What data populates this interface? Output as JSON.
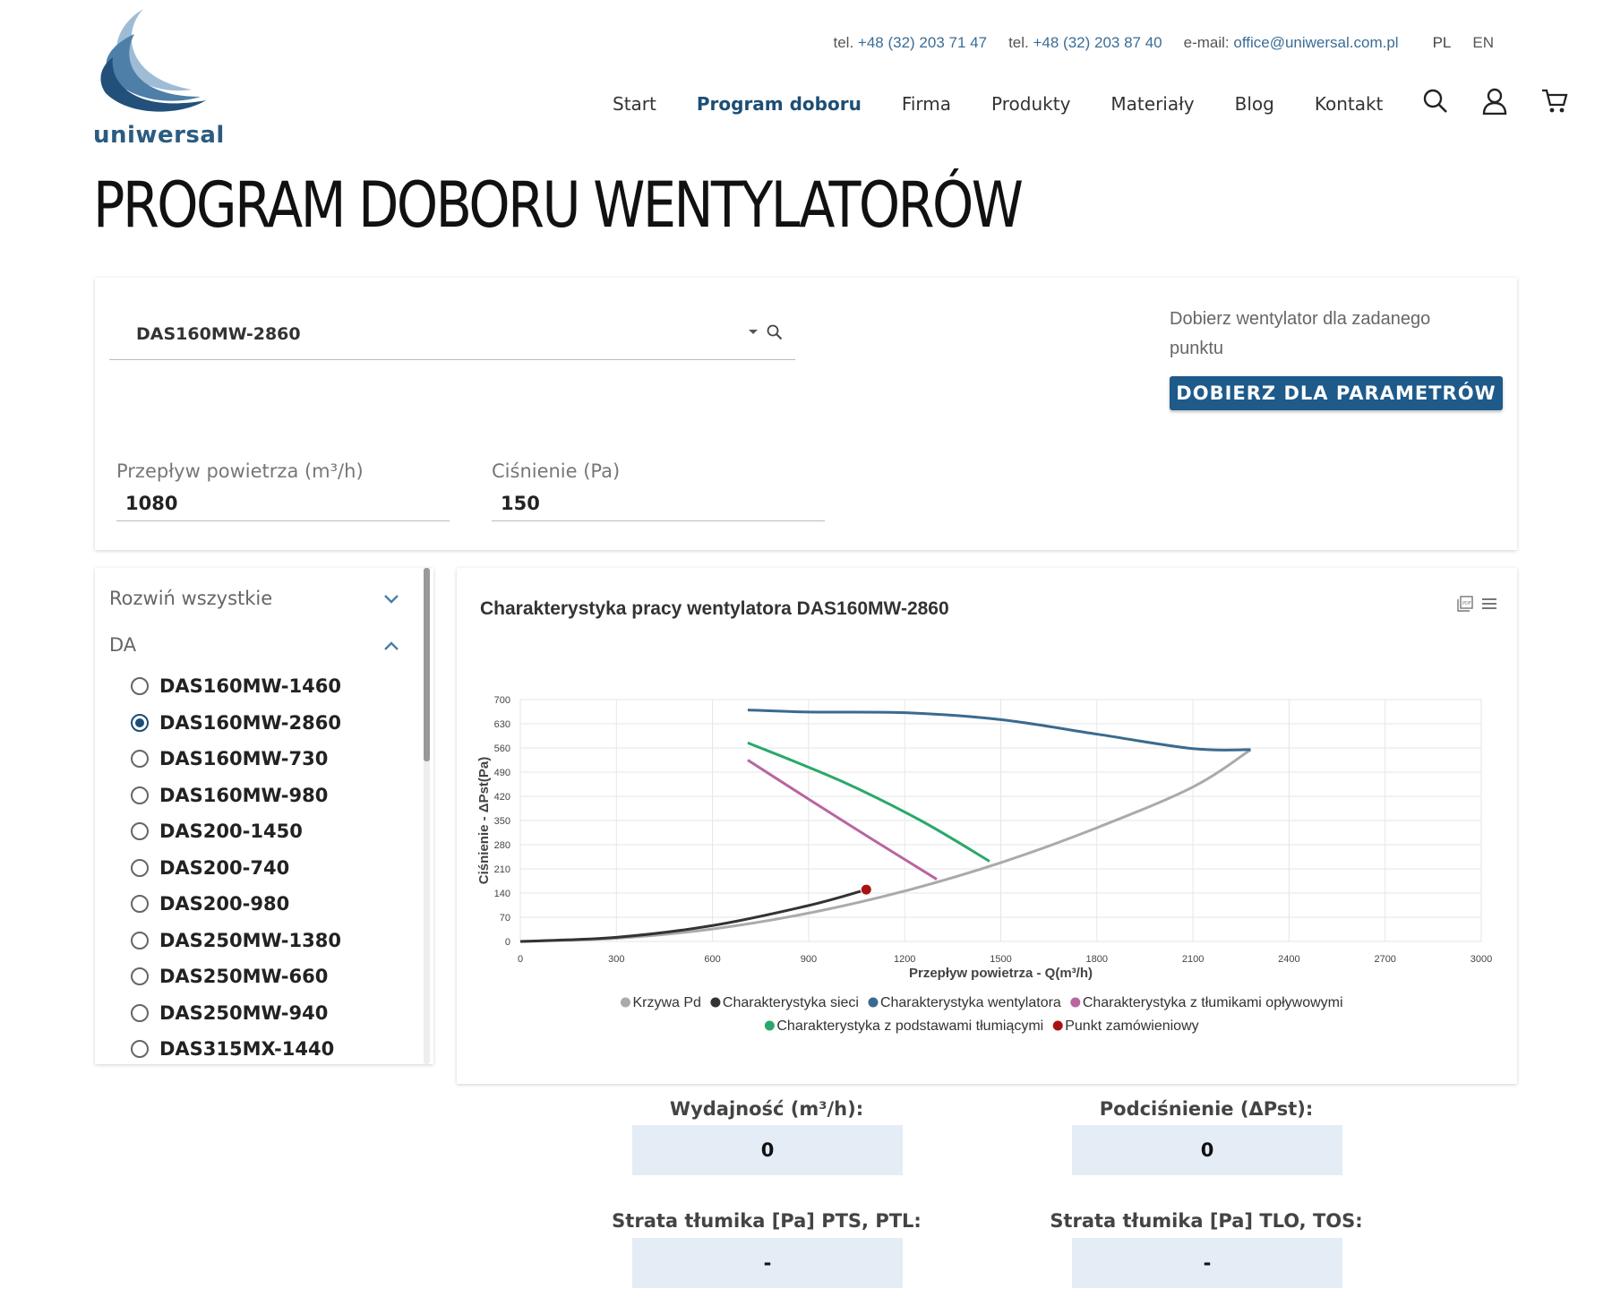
{
  "brand": {
    "name": "uniwersal"
  },
  "contact": {
    "tel1_label": "tel.",
    "tel1": "+48 (32) 203 71 47",
    "tel2_label": "tel.",
    "tel2": "+48 (32) 203 87 40",
    "email_label": "e-mail:",
    "email": "office@uniwersal.com.pl",
    "lang_pl": "PL",
    "lang_en": "EN"
  },
  "nav": {
    "items": [
      {
        "label": "Start",
        "active": false
      },
      {
        "label": "Program doboru",
        "active": true
      },
      {
        "label": "Firma",
        "active": false
      },
      {
        "label": "Produkty",
        "active": false
      },
      {
        "label": "Materiały",
        "active": false
      },
      {
        "label": "Blog",
        "active": false
      },
      {
        "label": "Kontakt",
        "active": false
      }
    ],
    "icons": [
      "search-icon",
      "user-icon",
      "cart-icon"
    ]
  },
  "page": {
    "title": "PROGRAM DOBORU WENTYLATORÓW"
  },
  "selector": {
    "value": "DAS160MW-2860",
    "pick_text": "Dobierz wentylator dla zadanego punktu",
    "pick_button": "DOBIERZ DLA PARAMETRÓW"
  },
  "fields": {
    "flow_label": "Przepływ powietrza (m³/h)",
    "flow_value": "1080",
    "pressure_label": "Ciśnienie (Pa)",
    "pressure_value": "150"
  },
  "sidebar": {
    "expand_all": "Rozwiń wszystkie",
    "group": "DA",
    "items": [
      {
        "label": "DAS160MW-1460",
        "selected": false
      },
      {
        "label": "DAS160MW-2860",
        "selected": true
      },
      {
        "label": "DAS160MW-730",
        "selected": false
      },
      {
        "label": "DAS160MW-980",
        "selected": false
      },
      {
        "label": "DAS200-1450",
        "selected": false
      },
      {
        "label": "DAS200-740",
        "selected": false
      },
      {
        "label": "DAS200-980",
        "selected": false
      },
      {
        "label": "DAS250MW-1380",
        "selected": false
      },
      {
        "label": "DAS250MW-660",
        "selected": false
      },
      {
        "label": "DAS250MW-940",
        "selected": false
      },
      {
        "label": "DAS315MX-1440",
        "selected": false
      }
    ]
  },
  "chart_data": {
    "type": "line",
    "title": "Charakterystyka pracy wentylatora DAS160MW-2860",
    "xlabel": "Przepływ powietrza - Q(m³/h)",
    "ylabel": "Ciśnienie - ΔPst(Pa)",
    "xlim": [
      0,
      3000
    ],
    "ylim": [
      0,
      700
    ],
    "xticks": [
      0,
      300,
      600,
      900,
      1200,
      1500,
      1800,
      2100,
      2400,
      2700,
      3000
    ],
    "yticks": [
      0,
      70,
      140,
      210,
      280,
      350,
      420,
      490,
      560,
      630,
      700
    ],
    "grid": true,
    "legend_position": "bottom",
    "series": [
      {
        "name": "Krzywa Pd",
        "color": "#aaaaaa",
        "x": [
          0,
          300,
          600,
          900,
          1200,
          1500,
          1800,
          2100,
          2280
        ],
        "y": [
          0,
          9,
          36,
          82,
          146,
          228,
          329,
          447,
          555
        ]
      },
      {
        "name": "Charakterystyka sieci",
        "color": "#333333",
        "x": [
          0,
          300,
          600,
          900,
          1080
        ],
        "y": [
          0,
          12,
          46,
          104,
          150
        ]
      },
      {
        "name": "Charakterystyka wentylatora",
        "color": "#3b6a8e",
        "x": [
          710,
          900,
          1200,
          1500,
          1800,
          2100,
          2280
        ],
        "y": [
          670,
          664,
          662,
          642,
          600,
          558,
          555
        ]
      },
      {
        "name": "Charakterystyka z tłumikami opływowymi",
        "color": "#b865a0",
        "x": [
          710,
          900,
          1100,
          1300
        ],
        "y": [
          525,
          412,
          295,
          180
        ]
      },
      {
        "name": "Charakterystyka z podstawami tłumiącymi",
        "color": "#2aa86a",
        "x": [
          710,
          1000,
          1250,
          1465
        ],
        "y": [
          575,
          465,
          350,
          232
        ]
      },
      {
        "name": "Punkt zamówieniowy",
        "color": "#aa1111",
        "x": [
          1080
        ],
        "y": [
          150
        ],
        "marker": true
      }
    ]
  },
  "results": {
    "flow_label": "Wydajność (m³/h):",
    "flow_value": "0",
    "pressure_label": "Podciśnienie (ΔPst):",
    "pressure_value": "0",
    "loss1_label": "Strata tłumika [Pa] PTS, PTL:",
    "loss1_value": "-",
    "loss2_label": "Strata tłumika [Pa] TLO, TOS:",
    "loss2_value": "-"
  }
}
